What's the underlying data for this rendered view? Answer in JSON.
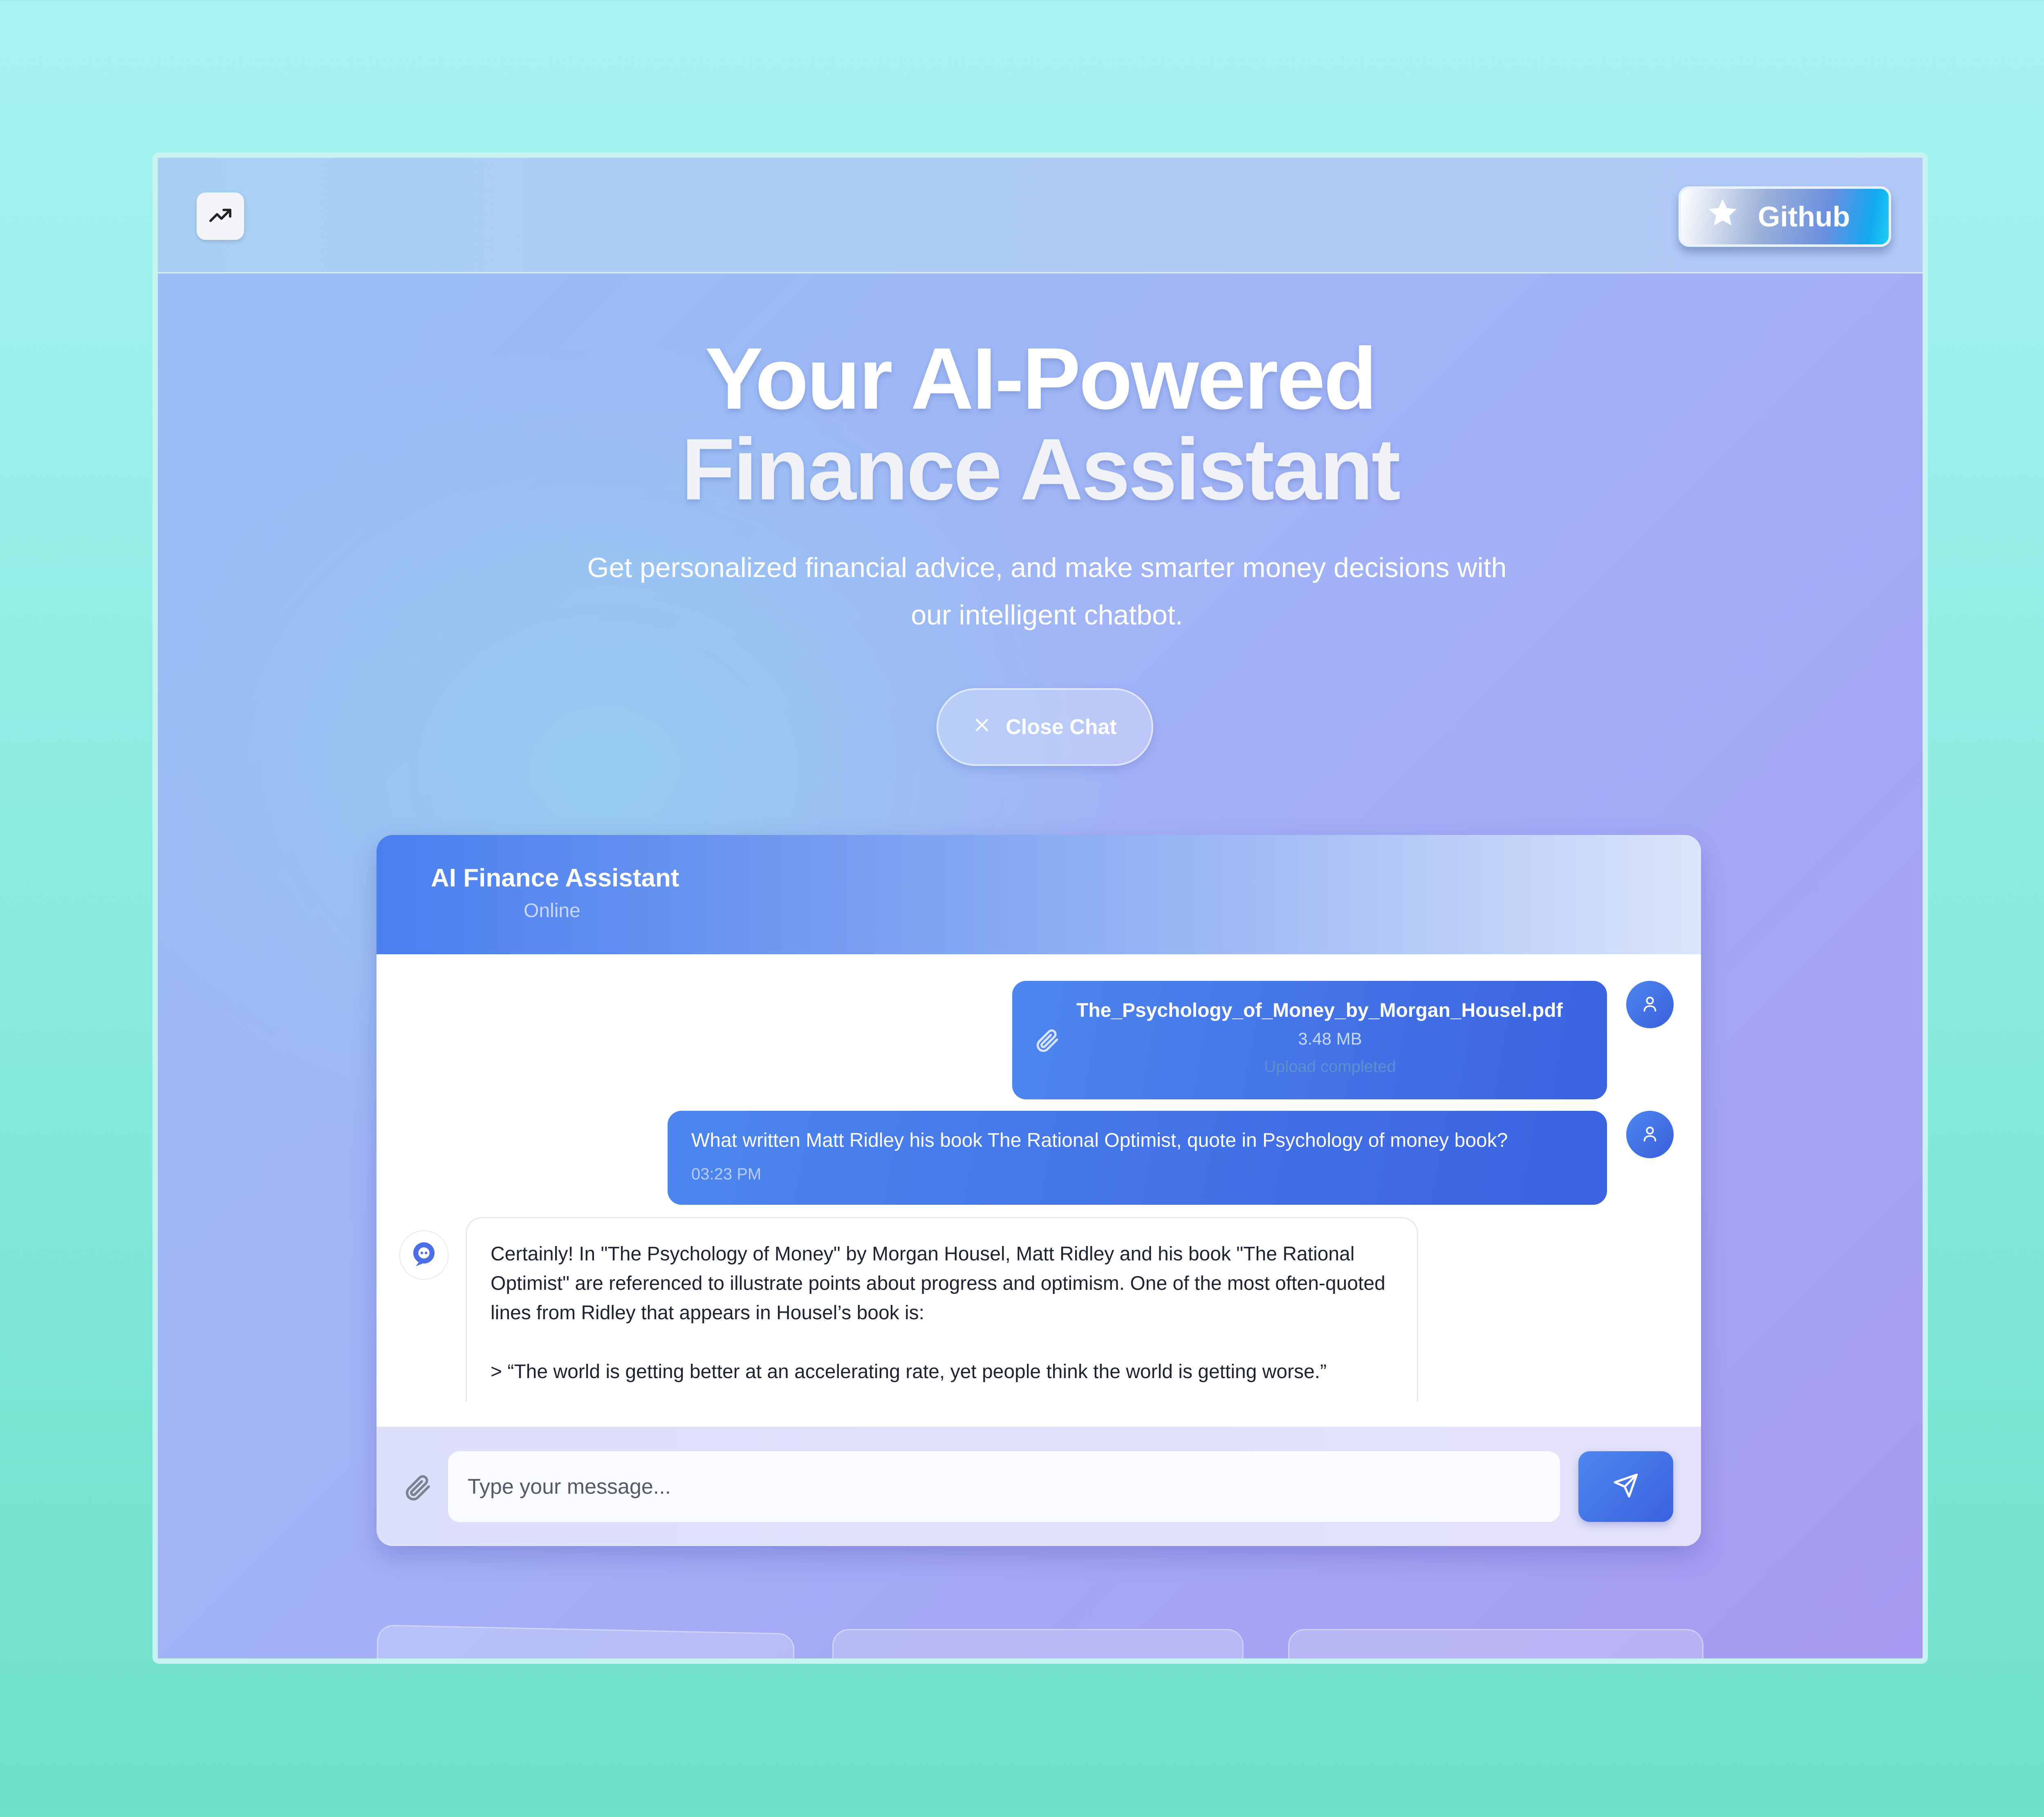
{
  "nav": {
    "logo_icon": "trending-up-icon",
    "github_label": "Github",
    "github_icon": "star-icon"
  },
  "hero": {
    "title_line1": "Your AI-Powered",
    "title_line2": "Finance Assistant",
    "subtitle": "Get personalized financial advice, and make smarter money decisions with our intelligent chatbot."
  },
  "close_chat": {
    "label": "Close Chat",
    "icon": "close-icon"
  },
  "chat": {
    "title": "AI Finance Assistant",
    "status": "Online",
    "messages": {
      "file": {
        "name": "The_Psychology_of_Money_by_Morgan_Housel.pdf",
        "size": "3.48 MB",
        "status": "Upload completed"
      },
      "user_message": {
        "text": "What written Matt Ridley his book The Rational Optimist, quote in Psychology of money book?",
        "time": "03:23 PM"
      },
      "bot_reply": {
        "paragraph1": "Certainly! In \"The Psychology of Money\" by Morgan Housel, Matt Ridley and his book \"The Rational Optimist\" are referenced to illustrate points about progress and optimism. One of the most often-quoted lines from Ridley that appears in Housel’s book is:",
        "paragraph2": "> “The world is getting better at an accelerating rate, yet people think the world is getting worse.”"
      }
    },
    "input": {
      "placeholder": "Type your message..."
    }
  },
  "colors": {
    "accent": "#3b62e0",
    "accent_light": "#4d86ee",
    "background": "#8aebe0"
  }
}
